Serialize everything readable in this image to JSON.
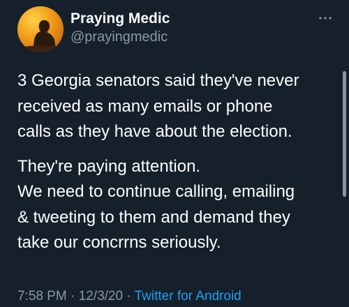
{
  "author": {
    "display_name": "Praying Medic",
    "handle": "@prayingmedic",
    "avatar_icon": "silhouette-sunset-avatar"
  },
  "menu": {
    "more_icon": "more-horizontal-icon"
  },
  "tweet": {
    "paragraph1": [
      "3 Georgia senators said they've never",
      "received as many emails or phone",
      "calls as they have about the election."
    ],
    "paragraph2": [
      "They're paying attention.",
      "We need to continue calling, emailing",
      "& tweeting to them and demand they",
      "take our concrrns seriously."
    ]
  },
  "meta": {
    "time": "7:58 PM",
    "separator": "·",
    "date": "12/3/20",
    "source": "Twitter for Android"
  },
  "colors": {
    "background": "#15202b",
    "secondary_text": "#8899a6",
    "link": "#1da1f2"
  }
}
